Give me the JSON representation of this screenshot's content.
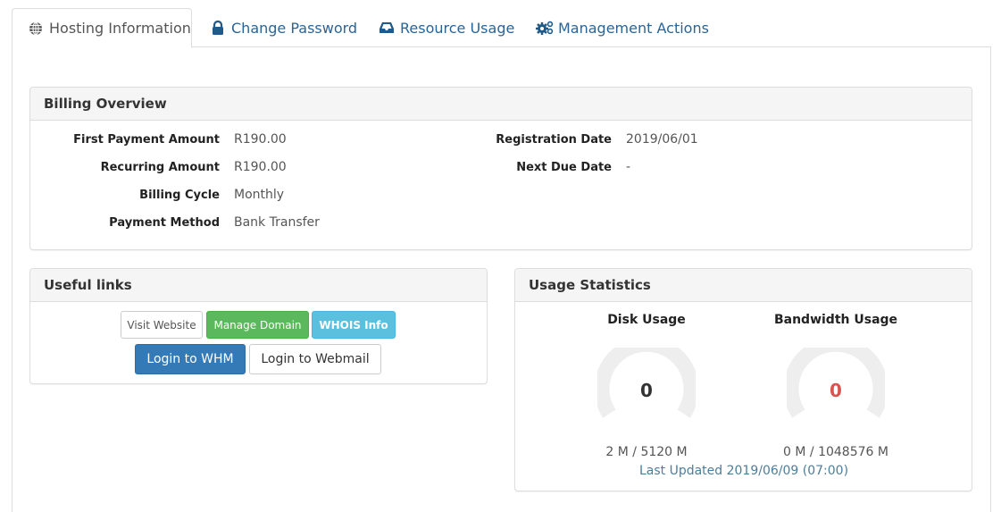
{
  "tabs": [
    {
      "label": "Hosting Information",
      "icon": "globe-icon",
      "active": true
    },
    {
      "label": "Change Password",
      "icon": "lock-icon",
      "active": false
    },
    {
      "label": "Resource Usage",
      "icon": "inbox-icon",
      "active": false
    },
    {
      "label": "Management Actions",
      "icon": "gears-icon",
      "active": false
    }
  ],
  "billing": {
    "title": "Billing Overview",
    "left": [
      {
        "label": "First Payment Amount",
        "value": "R190.00"
      },
      {
        "label": "Recurring Amount",
        "value": "R190.00"
      },
      {
        "label": "Billing Cycle",
        "value": "Monthly"
      },
      {
        "label": "Payment Method",
        "value": "Bank Transfer"
      }
    ],
    "right": [
      {
        "label": "Registration Date",
        "value": "2019/06/01"
      },
      {
        "label": "Next Due Date",
        "value": "-"
      }
    ]
  },
  "useful_links": {
    "title": "Useful links",
    "buttons": {
      "visit_website": "Visit Website",
      "manage_domain": "Manage Domain",
      "whois_info": "WHOIS Info",
      "login_whm": "Login to WHM",
      "login_webmail": "Login to Webmail"
    }
  },
  "usage": {
    "title": "Usage Statistics",
    "disk": {
      "label": "Disk Usage",
      "gauge_value": "0",
      "percent": 0,
      "usage": "2 M / 5120 M",
      "value_color": "#333333"
    },
    "bandwidth": {
      "label": "Bandwidth Usage",
      "gauge_value": "0",
      "percent": 0,
      "usage": "0 M / 1048576 M",
      "value_color": "#d9534f"
    },
    "last_updated": "Last Updated 2019/06/09 (07:00)"
  },
  "colors": {
    "link": "#2a6496",
    "primary": "#337ab7",
    "success": "#5cb85c",
    "info": "#5bc0de",
    "gauge_track": "#eeeeee"
  }
}
